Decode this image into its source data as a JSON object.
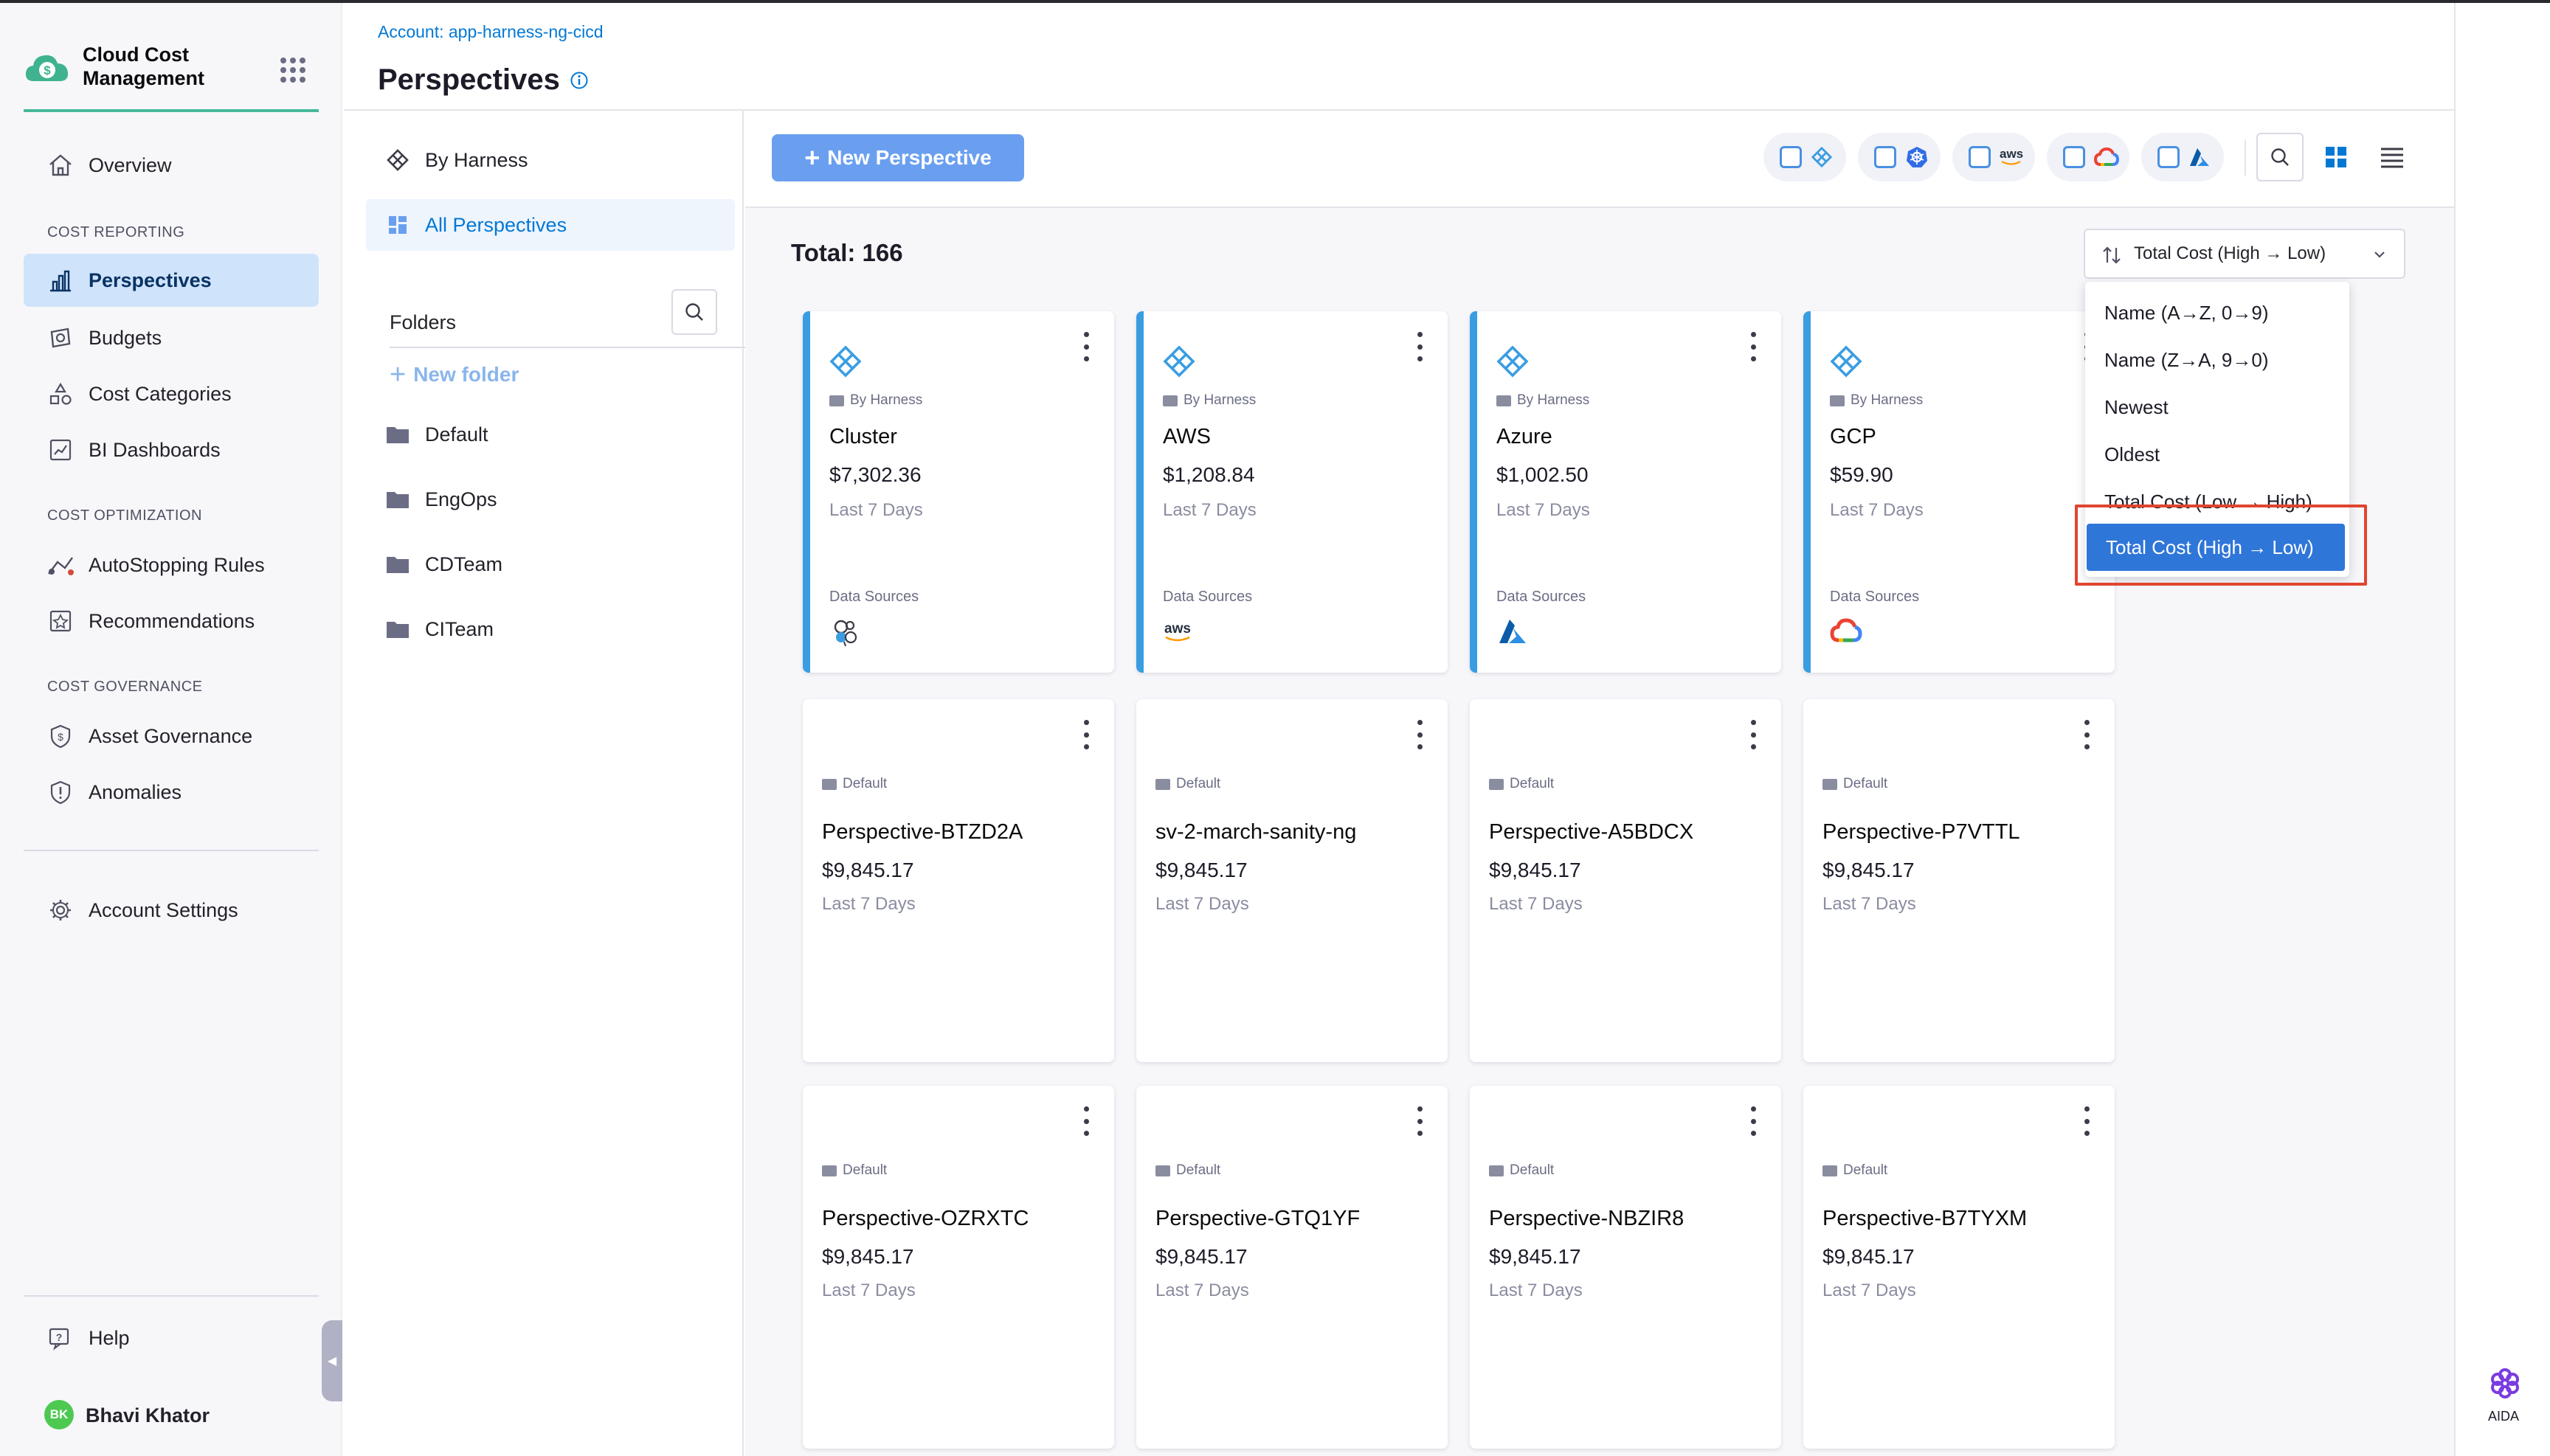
{
  "app": {
    "brand_line1": "Cloud Cost",
    "brand_line2": "Management",
    "brand_color": "#47b99a"
  },
  "sidebar": {
    "overview": "Overview",
    "section_reporting": "COST REPORTING",
    "perspectives": "Perspectives",
    "budgets": "Budgets",
    "cost_categories": "Cost Categories",
    "bi_dashboards": "BI Dashboards",
    "section_optimization": "COST OPTIMIZATION",
    "autostopping": "AutoStopping Rules",
    "recommendations": "Recommendations",
    "section_governance": "COST GOVERNANCE",
    "asset_governance": "Asset Governance",
    "anomalies": "Anomalies",
    "account_settings": "Account Settings",
    "help": "Help",
    "user_initials": "BK",
    "user_name": "Bhavi Khator"
  },
  "header": {
    "breadcrumb": "Account: app-harness-ng-cicd",
    "title": "Perspectives"
  },
  "folders_panel": {
    "by_harness": "By Harness",
    "all_perspectives": "All Perspectives",
    "folders_label": "Folders",
    "new_folder": "New folder",
    "folders": [
      "Default",
      "EngOps",
      "CDTeam",
      "CITeam"
    ]
  },
  "toolbar": {
    "new_perspective": "New Perspective",
    "filter_icons": [
      "harness-icon",
      "kubernetes-icon",
      "aws-icon",
      "gcp-icon",
      "azure-icon"
    ],
    "aws_text": "aws"
  },
  "main": {
    "total": "Total: 166",
    "sort_selected": "Total Cost (High → Low)",
    "sort_options": [
      "Name (A→Z, 0→9)",
      "Name (Z→A, 9→0)",
      "Newest",
      "Oldest",
      "Total Cost (Low → High)",
      "Total Cost (High → Low)"
    ],
    "data_sources_label": "Data Sources",
    "period": "Last 7 Days",
    "cards": [
      {
        "folder": "By Harness",
        "name": "Cluster",
        "cost": "$7,302.36",
        "source": "kubernetes-icon"
      },
      {
        "folder": "By Harness",
        "name": "AWS",
        "cost": "$1,208.84",
        "source": "aws-icon"
      },
      {
        "folder": "By Harness",
        "name": "Azure",
        "cost": "$1,002.50",
        "source": "azure-icon"
      },
      {
        "folder": "By Harness",
        "name": "GCP",
        "cost": "$59.90",
        "source": "gcp-icon"
      },
      {
        "folder": "Default",
        "name": "Perspective-BTZD2A",
        "cost": "$9,845.17"
      },
      {
        "folder": "Default",
        "name": "sv-2-march-sanity-ng",
        "cost": "$9,845.17"
      },
      {
        "folder": "Default",
        "name": "Perspective-A5BDCX",
        "cost": "$9,845.17"
      },
      {
        "folder": "Default",
        "name": "Perspective-P7VTTL",
        "cost": "$9,845.17"
      },
      {
        "folder": "Default",
        "name": "Perspective-OZRXTC",
        "cost": "$9,845.17"
      },
      {
        "folder": "Default",
        "name": "Perspective-GTQ1YF",
        "cost": "$9,845.17"
      },
      {
        "folder": "Default",
        "name": "Perspective-NBZIR8",
        "cost": "$9,845.17"
      },
      {
        "folder": "Default",
        "name": "Perspective-B7TYXM",
        "cost": "$9,845.17"
      }
    ]
  },
  "aida": {
    "label": "AIDA"
  }
}
